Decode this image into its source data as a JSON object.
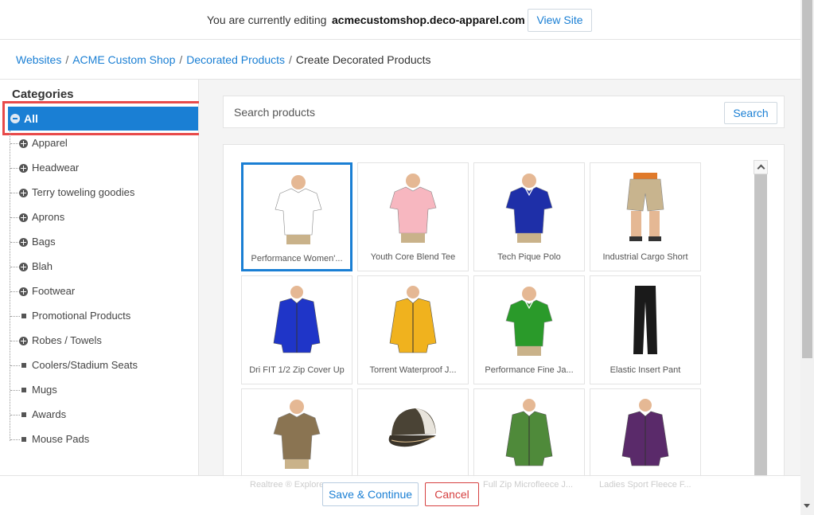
{
  "topbar": {
    "editing_text": "You are currently editing",
    "domain": "acmecustomshop.deco-apparel.com",
    "view_site_label": "View Site"
  },
  "breadcrumb": [
    {
      "label": "Websites",
      "link": true
    },
    {
      "label": "ACME Custom Shop",
      "link": true
    },
    {
      "label": "Decorated Products",
      "link": true
    },
    {
      "label": "Create Decorated Products",
      "link": false
    }
  ],
  "sidebar": {
    "title": "Categories",
    "selected": "All",
    "items": [
      {
        "label": "Apparel",
        "expandable": true
      },
      {
        "label": "Headwear",
        "expandable": true
      },
      {
        "label": "Terry toweling goodies",
        "expandable": true
      },
      {
        "label": "Aprons",
        "expandable": true
      },
      {
        "label": "Bags",
        "expandable": true
      },
      {
        "label": "Blah",
        "expandable": true
      },
      {
        "label": "Footwear",
        "expandable": true
      },
      {
        "label": "Promotional Products",
        "expandable": false
      },
      {
        "label": "Robes / Towels",
        "expandable": true
      },
      {
        "label": "Coolers/Stadium Seats",
        "expandable": false
      },
      {
        "label": "Mugs",
        "expandable": false
      },
      {
        "label": "Awards",
        "expandable": false
      },
      {
        "label": "Mouse Pads",
        "expandable": false
      }
    ]
  },
  "search": {
    "placeholder": "Search products",
    "button_label": "Search"
  },
  "products": [
    {
      "name": "Performance Women'...",
      "icon": "tshirt-icon",
      "color": "#ffffff",
      "selected": true
    },
    {
      "name": "Youth Core Blend Tee",
      "icon": "tshirt-icon",
      "color": "#f7b7c0",
      "selected": false
    },
    {
      "name": "Tech Pique Polo",
      "icon": "polo-icon",
      "color": "#1e2fa8",
      "selected": false
    },
    {
      "name": "Industrial Cargo Short",
      "icon": "shorts-icon",
      "color": "#c8b48e",
      "selected": false
    },
    {
      "name": "Dri FIT 1/2 Zip Cover Up",
      "icon": "jacket-icon",
      "color": "#1f35c8",
      "selected": false
    },
    {
      "name": "Torrent Waterproof J...",
      "icon": "jacket-icon",
      "color": "#f0b21e",
      "selected": false
    },
    {
      "name": "Performance Fine Ja...",
      "icon": "polo-icon",
      "color": "#2a9a2a",
      "selected": false
    },
    {
      "name": "Elastic Insert Pant",
      "icon": "pants-icon",
      "color": "#1a1a1a",
      "selected": false
    },
    {
      "name": "Realtree ® Explorer...",
      "icon": "tshirt-icon",
      "color": "#8a7452",
      "selected": false
    },
    {
      "name": "",
      "icon": "cap-icon",
      "color": "#4a4335",
      "selected": false
    },
    {
      "name": "Full Zip Microfleece J...",
      "icon": "jacket-icon",
      "color": "#4f8a3a",
      "selected": false
    },
    {
      "name": "Ladies Sport Fleece F...",
      "icon": "jacket-icon",
      "color": "#5a2a6a",
      "selected": false
    }
  ],
  "footer": {
    "save_label": "Save & Continue",
    "cancel_label": "Cancel"
  },
  "colors": {
    "accent": "#1a7fd4",
    "highlight": "#e84a4a",
    "cancel": "#d64040"
  }
}
